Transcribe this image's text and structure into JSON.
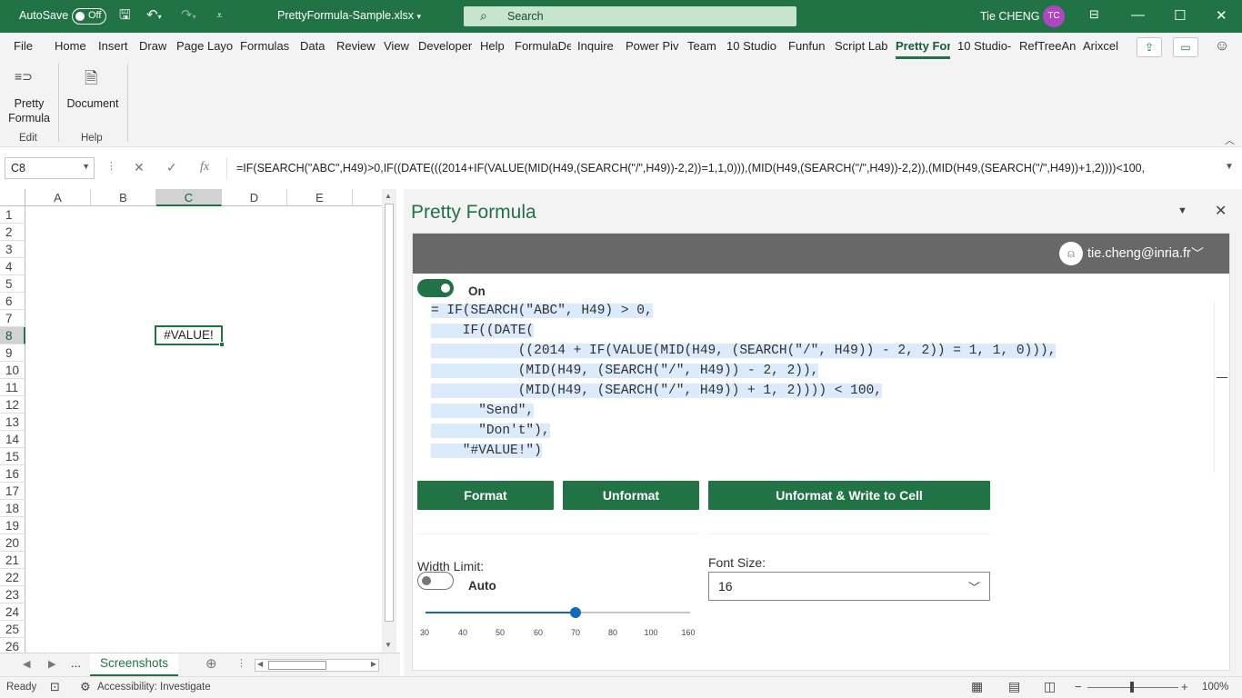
{
  "titlebar": {
    "autosave_label": "AutoSave",
    "autosave_state": "Off",
    "document_name": "PrettyFormula-Sample.xlsx",
    "search_placeholder": "Search",
    "user_name": "Tie CHENG",
    "user_initials": "TC"
  },
  "tabs": [
    "File",
    "Home",
    "Insert",
    "Draw",
    "Page Layo",
    "Formulas",
    "Data",
    "Review",
    "View",
    "Developer",
    "Help",
    "FormulaDe",
    "Inquire",
    "Power Pivo",
    "Team",
    "10 Studio",
    "Funfun",
    "Script Lab",
    "Pretty For",
    "10 Studio-",
    "RefTreeAn",
    "Arixcel"
  ],
  "active_tab": "Pretty For",
  "ribbon": {
    "groups": [
      {
        "button": "Pretty Formula",
        "group_label": "Edit"
      },
      {
        "button": "Document",
        "group_label": "Help"
      }
    ]
  },
  "formula_bar": {
    "name_box": "C8",
    "formula": "=IF(SEARCH(\"ABC\",H49)>0,IF((DATE(((2014+IF(VALUE(MID(H49,(SEARCH(\"/\",H49))-2,2))=1,1,0))),(MID(H49,(SEARCH(\"/\",H49))-2,2)),(MID(H49,(SEARCH(\"/\",H49))+1,2))))<100,"
  },
  "grid": {
    "columns": [
      "A",
      "B",
      "C",
      "D",
      "E"
    ],
    "selected_column": "C",
    "rows": [
      "1",
      "2",
      "3",
      "4",
      "5",
      "6",
      "7",
      "8",
      "9",
      "10",
      "11",
      "12",
      "13",
      "14",
      "15",
      "16",
      "17",
      "18",
      "19",
      "20",
      "21",
      "22",
      "23",
      "24",
      "25",
      "26"
    ],
    "selected_row": "8",
    "selected_cell_value": "#VALUE!"
  },
  "sheet_tabs": {
    "ellipsis": "...",
    "active": "Screenshots"
  },
  "statusbar": {
    "ready": "Ready",
    "accessibility": "Accessibility: Investigate",
    "zoom": "100%"
  },
  "pane": {
    "title": "Pretty Formula",
    "user_email": "tie.cheng@inria.fr",
    "toggle_label": "On",
    "formula_lines": [
      "= IF(SEARCH(\"ABC\", H49) > 0,",
      "    IF((DATE(",
      "           ((2014 + IF(VALUE(MID(H49, (SEARCH(\"/\", H49)) - 2, 2)) = 1, 1, 0))),",
      "           (MID(H49, (SEARCH(\"/\", H49)) - 2, 2)),",
      "           (MID(H49, (SEARCH(\"/\", H49)) + 1, 2)))) < 100,",
      "      \"Send\",",
      "      \"Don't\"),",
      "    \"#VALUE!\")"
    ],
    "buttons": {
      "format": "Format",
      "unformat": "Unformat",
      "unformat_write": "Unformat & Write to Cell"
    },
    "width_limit_label": "Width Limit:",
    "width_auto_label": "Auto",
    "slider_value": 70,
    "slider_ticks": [
      "30",
      "40",
      "50",
      "60",
      "70",
      "80",
      "100",
      "160"
    ],
    "font_size_label": "Font Size:",
    "font_size_value": "16"
  }
}
